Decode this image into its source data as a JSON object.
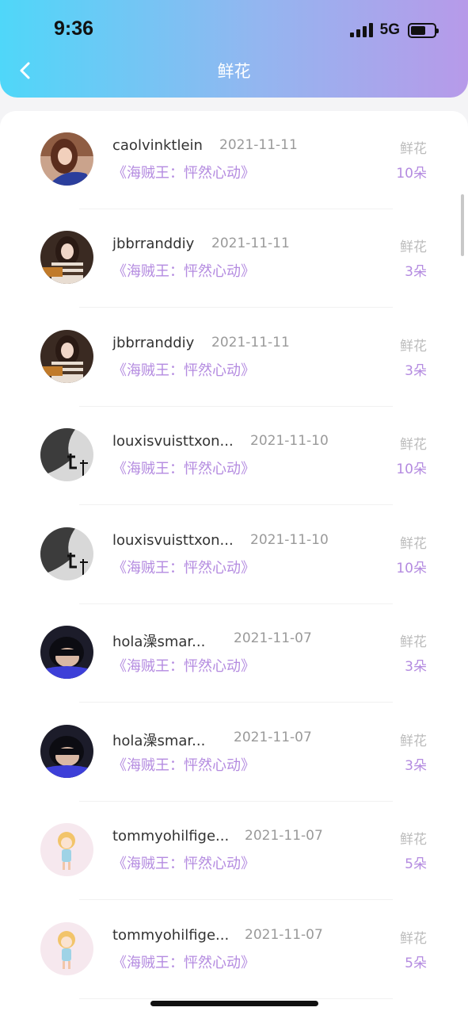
{
  "status_bar": {
    "time": "9:36",
    "network": "5G"
  },
  "header": {
    "title": "鲜花"
  },
  "icons": {
    "back": "chevron-left-icon",
    "signal": "signal-icon",
    "battery": "battery-icon"
  },
  "colors": {
    "gradient_start": "#4fd7f9",
    "gradient_end": "#b79ae9",
    "accent": "#b48be0"
  },
  "list": [
    {
      "username": "caolvinktlein",
      "date": "2021-11-11",
      "gift_title": "《海贼王：怦然心动》",
      "gift_label": "鲜花",
      "gift_count": "10朵",
      "avatar": "woman-blue-top"
    },
    {
      "username": "jbbrranddiy",
      "date": "2021-11-11",
      "gift_title": "《海贼王：怦然心动》",
      "gift_label": "鲜花",
      "gift_count": "3朵",
      "avatar": "woman-striped-sweater"
    },
    {
      "username": "jbbrranddiy",
      "date": "2021-11-11",
      "gift_title": "《海贼王：怦然心动》",
      "gift_label": "鲜花",
      "gift_count": "3朵",
      "avatar": "woman-striped-sweater"
    },
    {
      "username": "louxisvuisttxon...",
      "date": "2021-11-10",
      "gift_title": "《海贼王：怦然心动》",
      "gift_label": "鲜花",
      "gift_count": "10朵",
      "avatar": "grayscale-calligraphy"
    },
    {
      "username": "louxisvuisttxon...",
      "date": "2021-11-10",
      "gift_title": "《海贼王：怦然心动》",
      "gift_label": "鲜花",
      "gift_count": "10朵",
      "avatar": "grayscale-calligraphy"
    },
    {
      "username": "hola澡smar...",
      "date": "2021-11-07",
      "gift_title": "《海贼王：怦然心动》",
      "gift_label": "鲜花",
      "gift_count": "3朵",
      "avatar": "child-dark-hair"
    },
    {
      "username": "hola澡smar...",
      "date": "2021-11-07",
      "gift_title": "《海贼王：怦然心动》",
      "gift_label": "鲜花",
      "gift_count": "3朵",
      "avatar": "child-dark-hair"
    },
    {
      "username": "tommyohilfige...",
      "date": "2021-11-07",
      "gift_title": "《海贼王：怦然心动》",
      "gift_label": "鲜花",
      "gift_count": "5朵",
      "avatar": "cartoon-girl"
    },
    {
      "username": "tommyohilfige...",
      "date": "2021-11-07",
      "gift_title": "《海贼王：怦然心动》",
      "gift_label": "鲜花",
      "gift_count": "5朵",
      "avatar": "cartoon-girl"
    }
  ]
}
